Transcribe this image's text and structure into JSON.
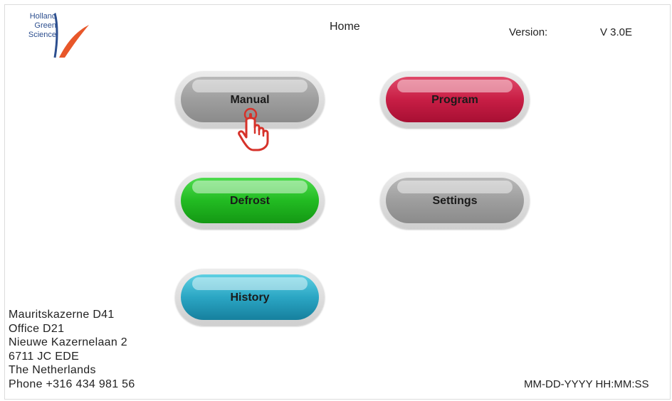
{
  "logo": {
    "lines": [
      "Holland",
      "Green",
      "Science"
    ],
    "colors": {
      "text": "#2d4f8f",
      "swoosh_blue": "#2d4f8f",
      "swoosh_orange": "#e8572a"
    }
  },
  "header": {
    "title": "Home",
    "version_label": "Version:",
    "version_value": "V 3.0E"
  },
  "buttons": {
    "manual": "Manual",
    "program": "Program",
    "defrost": "Defrost",
    "settings": "Settings",
    "history": "History"
  },
  "button_colors": {
    "manual": "#9e9e9e",
    "program": "#c81e45",
    "defrost": "#22bb22",
    "settings": "#9e9e9e",
    "history": "#2ba6c4"
  },
  "address": [
    "Mauritskazerne D41",
    "Office D21",
    "Nieuwe Kazernelaan 2",
    "6711 JC EDE",
    "The Netherlands",
    "Phone +316 434 981 56"
  ],
  "datetime": "MM-DD-YYYY HH:MM:SS",
  "icons": {
    "pointer": "hand-pointer-icon",
    "logo": "logo-swoosh-icon"
  }
}
